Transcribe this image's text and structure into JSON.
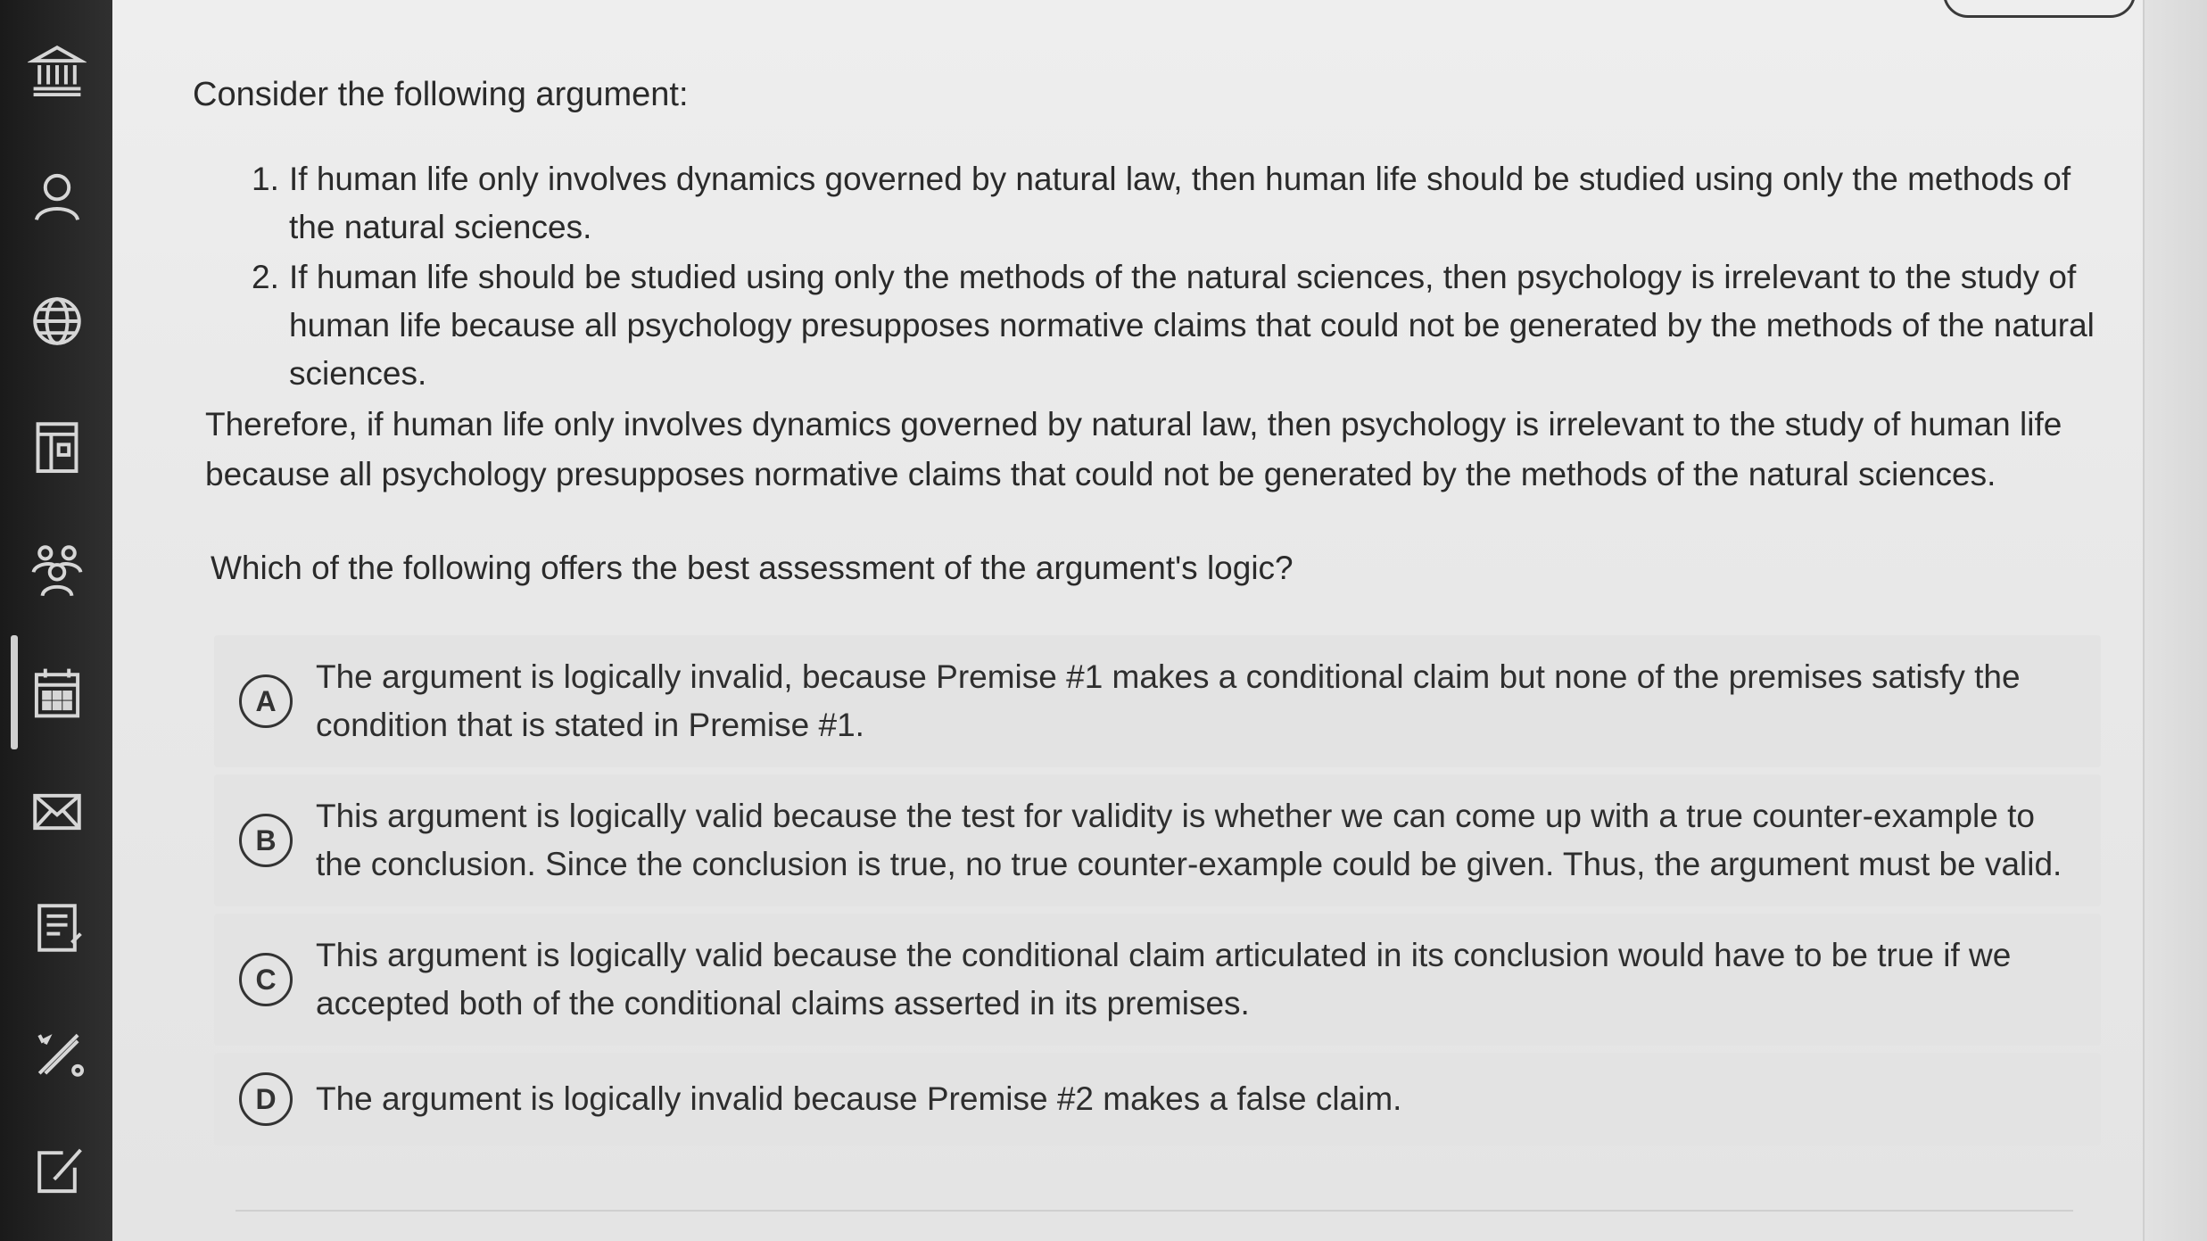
{
  "question": {
    "prompt": "Consider the following argument:",
    "premises": [
      {
        "number": "1.",
        "text": "If human life only involves dynamics governed by natural law, then human life should be studied using only the methods of the natural sciences."
      },
      {
        "number": "2.",
        "text": "If human life should be studied using only the methods of the natural sciences, then psychology is irrelevant to the study of human life because all psychology presupposes normative claims that could not be generated by the methods of the natural sciences."
      }
    ],
    "conclusion": "Therefore, if human life only involves dynamics governed by natural law, then psychology is irrelevant to the study of human life because all psychology presupposes normative claims that could not be generated by the methods of the natural sciences.",
    "ask": "Which of the following offers the best assessment of the argument's logic?"
  },
  "options": [
    {
      "letter": "A",
      "text": "The argument is logically invalid, because Premise #1 makes a conditional claim but none of the premises satisfy the condition that is stated in Premise #1."
    },
    {
      "letter": "B",
      "text": "This argument is logically valid because the test for validity is whether we can come up with a true counter-example to the conclusion. Since the conclusion is true, no true counter-example could be given. Thus, the argument must be valid."
    },
    {
      "letter": "C",
      "text": "This argument is logically valid because the conditional claim articulated in its conclusion would have to be true if we accepted both of the conditional claims asserted in its premises."
    },
    {
      "letter": "D",
      "text": "The argument is logically invalid because Premise #2 makes a false claim."
    }
  ],
  "sidebar": {
    "icons": [
      "institution-icon",
      "user-icon",
      "globe-icon",
      "dashboard-icon",
      "groups-icon",
      "calendar-icon",
      "inbox-icon",
      "history-icon",
      "commons-icon",
      "edit-icon"
    ],
    "active_index": 5
  },
  "colors": {
    "rail": "#262626",
    "background": "#e9e9e9",
    "option_bg": "#e3e3e3",
    "text": "#2a2a2a"
  }
}
